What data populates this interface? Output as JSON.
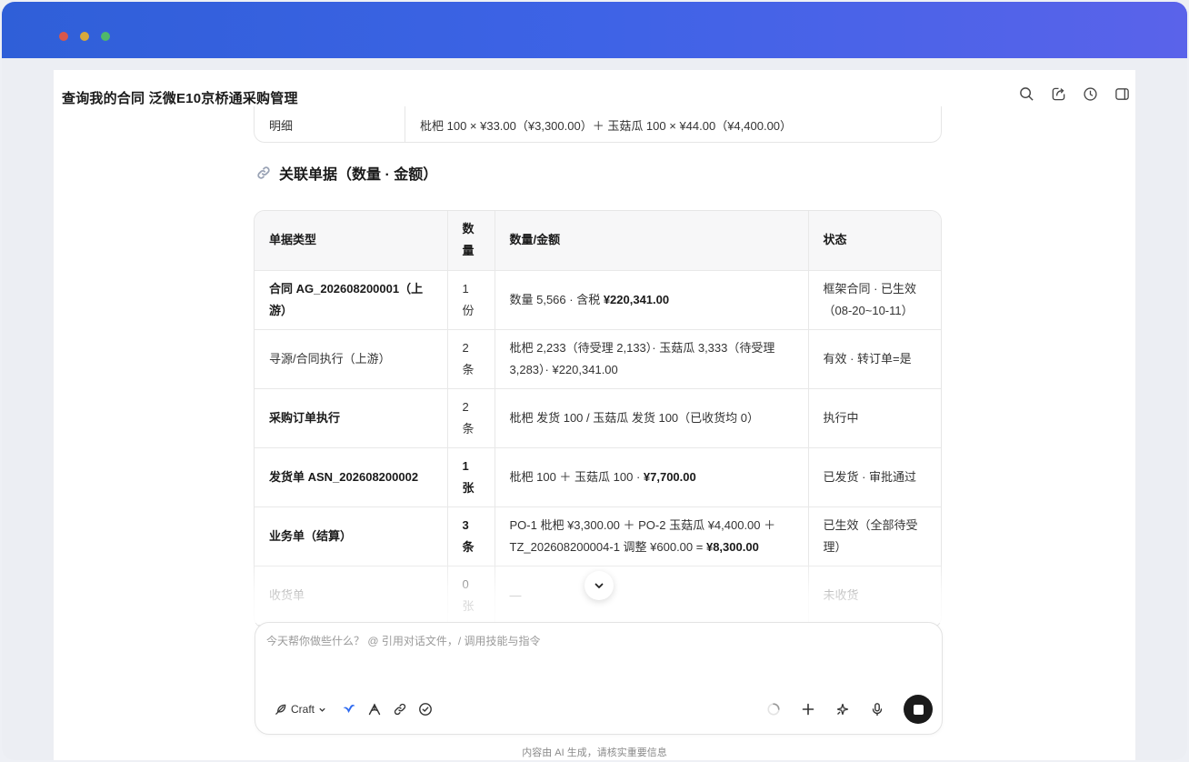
{
  "window": {
    "title": "查询我的合同 泛微E10京桥通采购管理"
  },
  "detail": {
    "label": "明细",
    "value": "枇杷 100 × ¥33.00（¥3,300.00）＋ 玉菇瓜 100 × ¥44.00（¥4,400.00）"
  },
  "section": {
    "icon": "link-icon",
    "title": "关联单据（数量 · 金额）"
  },
  "table": {
    "headers": [
      "单据类型",
      "数量",
      "数量/金额",
      "状态"
    ],
    "rows": [
      {
        "type": "合同 AG_202608200001（上游）",
        "count": "1份",
        "amount_a": "数量 5,566 · 含税 ",
        "amount_b": "¥220,341.00",
        "amount_c": "",
        "status": "框架合同 · 已生效（08-20~10-11）"
      },
      {
        "type": "寻源/合同执行（上游）",
        "count": "2条",
        "amount_a": "枇杷 2,233（待受理 2,133）· 玉菇瓜 3,333（待受理 3,283）· ¥220,341.00",
        "amount_b": "",
        "amount_c": "",
        "status": "有效 · 转订单=是"
      },
      {
        "type": "采购订单执行",
        "count": "2条",
        "amount_a": "枇杷 发货 100 / 玉菇瓜 发货 100（已收货均 0）",
        "amount_b": "",
        "amount_c": "",
        "status": "执行中"
      },
      {
        "type": "发货单 ASN_202608200002",
        "count": "1张",
        "amount_a": "枇杷 100 ＋ 玉菇瓜 100 · ",
        "amount_b": "¥7,700.00",
        "amount_c": "",
        "status": "已发货 · 审批通过"
      },
      {
        "type": "业务单（结算）",
        "count": "3条",
        "amount_a": "PO-1 枇杷 ¥3,300.00 ＋ PO-2 玉菇瓜 ¥4,400.00 ＋ TZ_202608200004-1 调整 ¥600.00 = ",
        "amount_b": "¥8,300.00",
        "amount_c": "",
        "status": "已生效（全部待受理）"
      },
      {
        "type": "收货单",
        "count": "0张",
        "amount_a": "—",
        "amount_b": "",
        "amount_c": "",
        "status": "未收货"
      }
    ]
  },
  "composer": {
    "placeholder": "今天帮你做些什么？ @ 引用对话文件，/ 调用技能与指令",
    "mode_label": "Craft"
  },
  "disclaimer": "内容由 AI 生成，请核实重要信息",
  "icons": {
    "header": [
      "search-icon",
      "share-icon",
      "history-icon",
      "sidebar-toggle-icon"
    ],
    "tools_left": [
      "brand-logo-icon",
      "pen-tool-icon",
      "link-icon",
      "check-circle-icon"
    ],
    "tools_right": [
      "loading-spinner-icon",
      "plus-icon",
      "sparkle-icon",
      "microphone-icon",
      "stop-icon"
    ]
  },
  "colors": {
    "titlebar_start": "#2f5fd8",
    "titlebar_end": "#5a63ea",
    "stop_button": "#1a1a1a",
    "brand_blue": "#2f6bf0"
  }
}
